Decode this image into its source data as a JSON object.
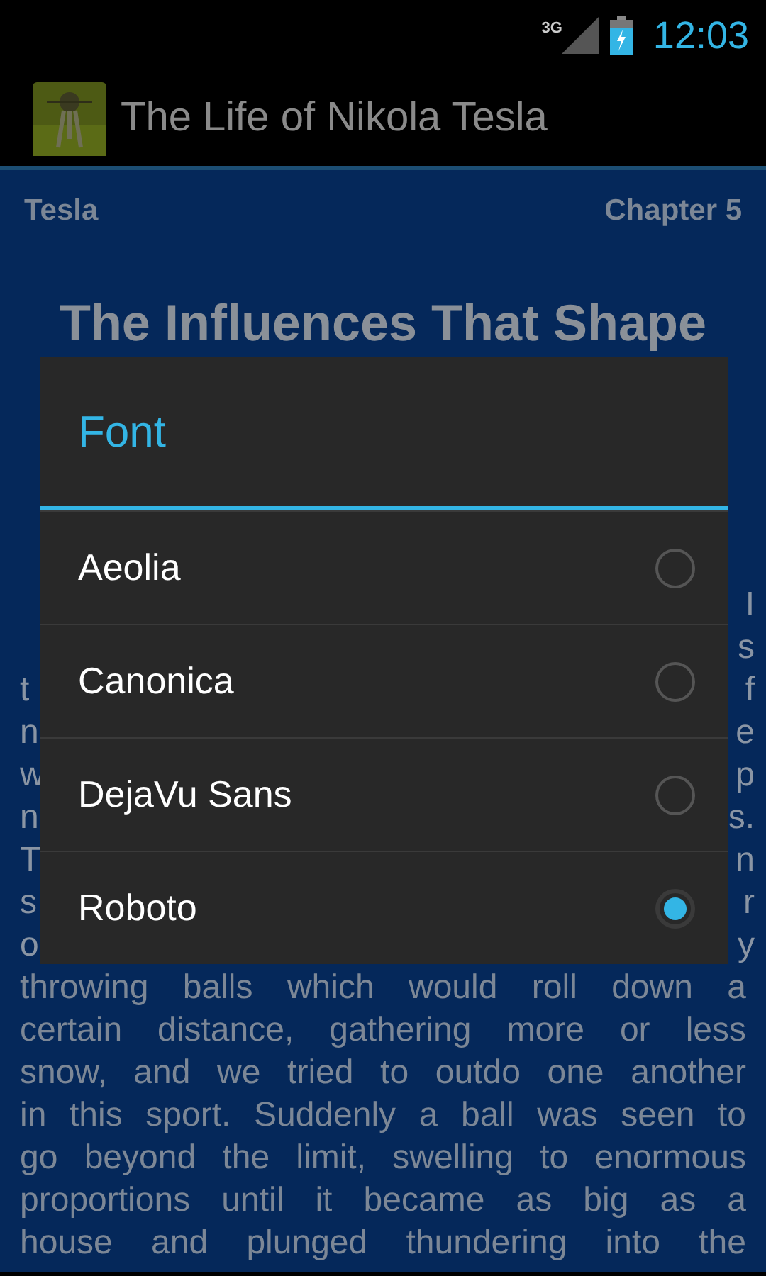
{
  "status_bar": {
    "network": "3G",
    "time": "12:03"
  },
  "action_bar": {
    "title": "The Life of Nikola Tesla"
  },
  "page": {
    "author": "Tesla",
    "chapter": "Chapter 5",
    "title": "The Influences That Shape",
    "edge_rows": [
      {
        "right": "I"
      },
      {
        "right": "s"
      },
      {
        "left": "t",
        "right": "f"
      },
      {
        "left": "n",
        "right": "e"
      },
      {
        "left": "w",
        "right": "p"
      },
      {
        "left": "n",
        "right": "s."
      },
      {
        "left": "T",
        "right": "n"
      },
      {
        "left": "s",
        "right": "r"
      },
      {
        "left": "o",
        "right": "y"
      }
    ],
    "lines": [
      "throwing balls which would roll down a",
      "certain distance, gathering more or less",
      "snow, and we tried to outdo one another",
      "in this sport. Suddenly a ball was seen to",
      "go beyond the limit, swelling to enormous",
      "proportions until it became as big as a",
      "house and plunged thundering into the"
    ]
  },
  "dialog": {
    "title": "Font",
    "options": [
      {
        "label": "Aeolia",
        "selected": false
      },
      {
        "label": "Canonica",
        "selected": false
      },
      {
        "label": "DejaVu Sans",
        "selected": false
      },
      {
        "label": "Roboto",
        "selected": true
      }
    ]
  }
}
